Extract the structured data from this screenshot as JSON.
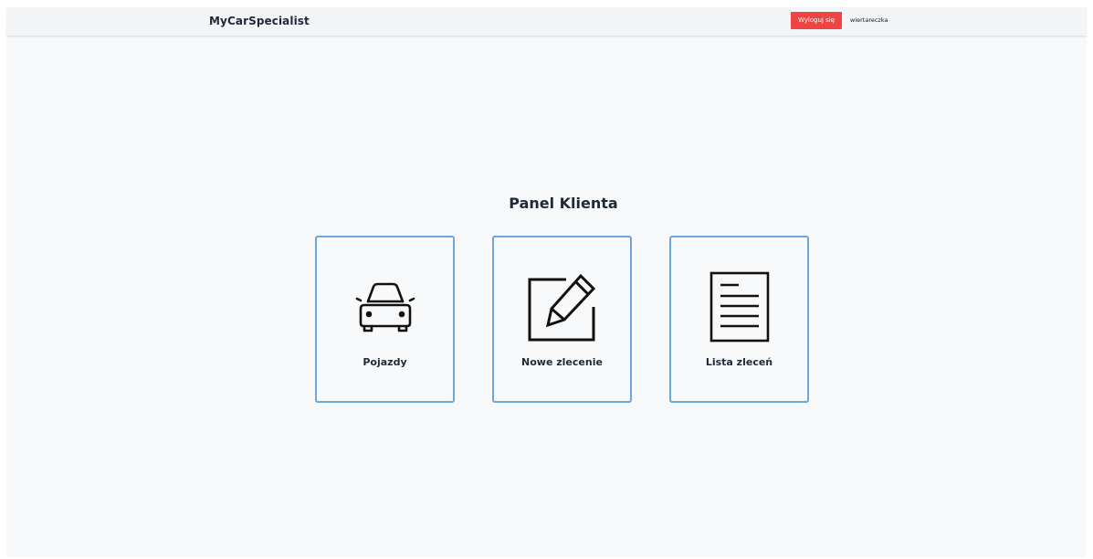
{
  "navbar": {
    "brand": "MyCarSpecialist",
    "logout_label": "Wyloguj się",
    "username": "wiertareczka"
  },
  "main": {
    "title": "Panel Klienta",
    "tiles": [
      {
        "label": "Pojazdy",
        "icon": "car-icon"
      },
      {
        "label": "Nowe zlecenie",
        "icon": "edit-document-icon"
      },
      {
        "label": "Lista zleceń",
        "icon": "document-list-icon"
      }
    ]
  },
  "colors": {
    "accent_border": "#6ea6dc",
    "logout": "#ef4444",
    "background": "#f6f8fa"
  }
}
